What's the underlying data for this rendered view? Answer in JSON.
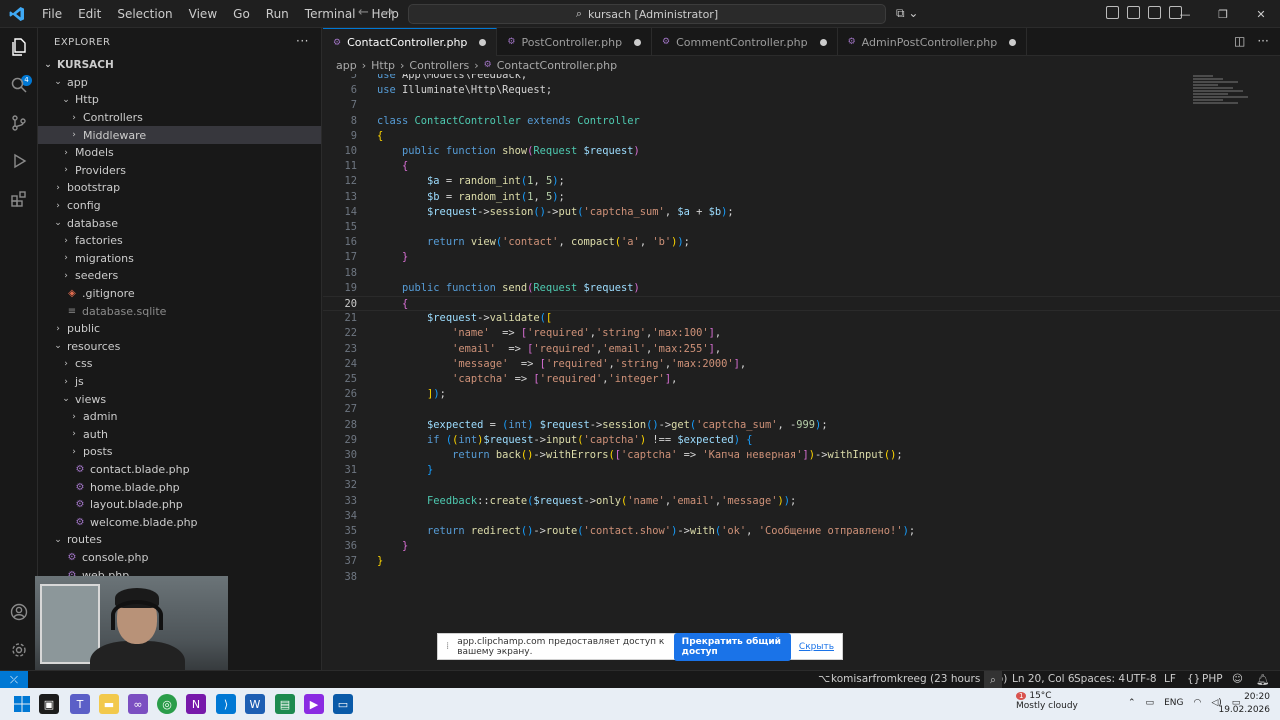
{
  "titlebar": {
    "menu": [
      "File",
      "Edit",
      "Selection",
      "View",
      "Go",
      "Run",
      "Terminal",
      "Help"
    ],
    "search_text": "kursach [Administrator]"
  },
  "sidebar": {
    "header": "EXPLORER",
    "root": "KURSACH",
    "items": [
      {
        "label": "app",
        "depth": 1,
        "type": "folder-open"
      },
      {
        "label": "Http",
        "depth": 2,
        "type": "folder-open"
      },
      {
        "label": "Controllers",
        "depth": 3,
        "type": "folder"
      },
      {
        "label": "Middleware",
        "depth": 3,
        "type": "folder",
        "selected": true
      },
      {
        "label": "Models",
        "depth": 2,
        "type": "folder"
      },
      {
        "label": "Providers",
        "depth": 2,
        "type": "folder"
      },
      {
        "label": "bootstrap",
        "depth": 1,
        "type": "folder"
      },
      {
        "label": "config",
        "depth": 1,
        "type": "folder"
      },
      {
        "label": "database",
        "depth": 1,
        "type": "folder-open"
      },
      {
        "label": "factories",
        "depth": 2,
        "type": "folder"
      },
      {
        "label": "migrations",
        "depth": 2,
        "type": "folder"
      },
      {
        "label": "seeders",
        "depth": 2,
        "type": "folder"
      },
      {
        "label": ".gitignore",
        "depth": 2,
        "type": "git"
      },
      {
        "label": "database.sqlite",
        "depth": 2,
        "type": "db",
        "dim": true
      },
      {
        "label": "public",
        "depth": 1,
        "type": "folder"
      },
      {
        "label": "resources",
        "depth": 1,
        "type": "folder-open"
      },
      {
        "label": "css",
        "depth": 2,
        "type": "folder"
      },
      {
        "label": "js",
        "depth": 2,
        "type": "folder"
      },
      {
        "label": "views",
        "depth": 2,
        "type": "folder-open"
      },
      {
        "label": "admin",
        "depth": 3,
        "type": "folder"
      },
      {
        "label": "auth",
        "depth": 3,
        "type": "folder"
      },
      {
        "label": "posts",
        "depth": 3,
        "type": "folder"
      },
      {
        "label": "contact.blade.php",
        "depth": 3,
        "type": "php"
      },
      {
        "label": "home.blade.php",
        "depth": 3,
        "type": "php"
      },
      {
        "label": "layout.blade.php",
        "depth": 3,
        "type": "php"
      },
      {
        "label": "welcome.blade.php",
        "depth": 3,
        "type": "php"
      },
      {
        "label": "routes",
        "depth": 1,
        "type": "folder-open"
      },
      {
        "label": "console.php",
        "depth": 2,
        "type": "php"
      },
      {
        "label": "web.php",
        "depth": 2,
        "type": "php"
      }
    ]
  },
  "tabs": [
    {
      "label": "ContactController.php",
      "active": true
    },
    {
      "label": "PostController.php",
      "active": false
    },
    {
      "label": "CommentController.php",
      "active": false
    },
    {
      "label": "AdminPostController.php",
      "active": false
    }
  ],
  "breadcrumb": [
    "app",
    "Http",
    "Controllers",
    "ContactController.php"
  ],
  "editor": {
    "current_line": 20,
    "lines": [
      {
        "n": 5,
        "tokens": [
          [
            "k",
            "use "
          ],
          [
            "p",
            "App\\Models\\Feedback;"
          ]
        ]
      },
      {
        "n": 6,
        "tokens": [
          [
            "k",
            "use "
          ],
          [
            "p",
            "Illuminate\\Http\\Request;"
          ]
        ]
      },
      {
        "n": 7,
        "tokens": []
      },
      {
        "n": 8,
        "tokens": [
          [
            "k",
            "class "
          ],
          [
            "c",
            "ContactController "
          ],
          [
            "k",
            "extends "
          ],
          [
            "c",
            "Controller"
          ]
        ]
      },
      {
        "n": 9,
        "tokens": [
          [
            "b1",
            "{"
          ]
        ]
      },
      {
        "n": 10,
        "tokens": [
          [
            "p",
            "    "
          ],
          [
            "k",
            "public function "
          ],
          [
            "f",
            "show"
          ],
          [
            "b2",
            "("
          ],
          [
            "c",
            "Request "
          ],
          [
            "v",
            "$request"
          ],
          [
            "b2",
            ")"
          ]
        ]
      },
      {
        "n": 11,
        "tokens": [
          [
            "p",
            "    "
          ],
          [
            "b2",
            "{"
          ]
        ]
      },
      {
        "n": 12,
        "tokens": [
          [
            "p",
            "        "
          ],
          [
            "v",
            "$a"
          ],
          [
            "p",
            " = "
          ],
          [
            "f",
            "random_int"
          ],
          [
            "b3",
            "("
          ],
          [
            "n",
            "1"
          ],
          [
            "p",
            ", "
          ],
          [
            "n",
            "5"
          ],
          [
            "b3",
            ")"
          ],
          [
            "p",
            ";"
          ]
        ]
      },
      {
        "n": 13,
        "tokens": [
          [
            "p",
            "        "
          ],
          [
            "v",
            "$b"
          ],
          [
            "p",
            " = "
          ],
          [
            "f",
            "random_int"
          ],
          [
            "b3",
            "("
          ],
          [
            "n",
            "1"
          ],
          [
            "p",
            ", "
          ],
          [
            "n",
            "5"
          ],
          [
            "b3",
            ")"
          ],
          [
            "p",
            ";"
          ]
        ]
      },
      {
        "n": 14,
        "tokens": [
          [
            "p",
            "        "
          ],
          [
            "v",
            "$request"
          ],
          [
            "p",
            "->"
          ],
          [
            "f",
            "session"
          ],
          [
            "b3",
            "()"
          ],
          [
            "p",
            "->"
          ],
          [
            "f",
            "put"
          ],
          [
            "b3",
            "("
          ],
          [
            "s",
            "'captcha_sum'"
          ],
          [
            "p",
            ", "
          ],
          [
            "v",
            "$a"
          ],
          [
            "p",
            " + "
          ],
          [
            "v",
            "$b"
          ],
          [
            "b3",
            ")"
          ],
          [
            "p",
            ";"
          ]
        ]
      },
      {
        "n": 15,
        "tokens": []
      },
      {
        "n": 16,
        "tokens": [
          [
            "p",
            "        "
          ],
          [
            "k",
            "return "
          ],
          [
            "f",
            "view"
          ],
          [
            "b3",
            "("
          ],
          [
            "s",
            "'contact'"
          ],
          [
            "p",
            ", "
          ],
          [
            "f",
            "compact"
          ],
          [
            "b1",
            "("
          ],
          [
            "s",
            "'a'"
          ],
          [
            "p",
            ", "
          ],
          [
            "s",
            "'b'"
          ],
          [
            "b1",
            ")"
          ],
          [
            "b3",
            ")"
          ],
          [
            "p",
            ";"
          ]
        ]
      },
      {
        "n": 17,
        "tokens": [
          [
            "p",
            "    "
          ],
          [
            "b2",
            "}"
          ]
        ]
      },
      {
        "n": 18,
        "tokens": []
      },
      {
        "n": 19,
        "tokens": [
          [
            "p",
            "    "
          ],
          [
            "k",
            "public function "
          ],
          [
            "f",
            "send"
          ],
          [
            "b2",
            "("
          ],
          [
            "c",
            "Request "
          ],
          [
            "v",
            "$request"
          ],
          [
            "b2",
            ")"
          ]
        ]
      },
      {
        "n": 20,
        "tokens": [
          [
            "p",
            "    "
          ],
          [
            "b2",
            "{"
          ]
        ]
      },
      {
        "n": 21,
        "tokens": [
          [
            "p",
            "        "
          ],
          [
            "v",
            "$request"
          ],
          [
            "p",
            "->"
          ],
          [
            "f",
            "validate"
          ],
          [
            "b3",
            "("
          ],
          [
            "b1",
            "["
          ]
        ]
      },
      {
        "n": 22,
        "tokens": [
          [
            "p",
            "            "
          ],
          [
            "s",
            "'name'"
          ],
          [
            "p",
            "  => "
          ],
          [
            "b2",
            "["
          ],
          [
            "s",
            "'required'"
          ],
          [
            "p",
            ","
          ],
          [
            "s",
            "'string'"
          ],
          [
            "p",
            ","
          ],
          [
            "s",
            "'max:100'"
          ],
          [
            "b2",
            "]"
          ],
          [
            "p",
            ","
          ]
        ]
      },
      {
        "n": 23,
        "tokens": [
          [
            "p",
            "            "
          ],
          [
            "s",
            "'email'"
          ],
          [
            "p",
            "  => "
          ],
          [
            "b2",
            "["
          ],
          [
            "s",
            "'required'"
          ],
          [
            "p",
            ","
          ],
          [
            "s",
            "'email'"
          ],
          [
            "p",
            ","
          ],
          [
            "s",
            "'max:255'"
          ],
          [
            "b2",
            "]"
          ],
          [
            "p",
            ","
          ]
        ]
      },
      {
        "n": 24,
        "tokens": [
          [
            "p",
            "            "
          ],
          [
            "s",
            "'message'"
          ],
          [
            "p",
            "  => "
          ],
          [
            "b2",
            "["
          ],
          [
            "s",
            "'required'"
          ],
          [
            "p",
            ","
          ],
          [
            "s",
            "'string'"
          ],
          [
            "p",
            ","
          ],
          [
            "s",
            "'max:2000'"
          ],
          [
            "b2",
            "]"
          ],
          [
            "p",
            ","
          ]
        ]
      },
      {
        "n": 25,
        "tokens": [
          [
            "p",
            "            "
          ],
          [
            "s",
            "'captcha'"
          ],
          [
            "p",
            " => "
          ],
          [
            "b2",
            "["
          ],
          [
            "s",
            "'required'"
          ],
          [
            "p",
            ","
          ],
          [
            "s",
            "'integer'"
          ],
          [
            "b2",
            "]"
          ],
          [
            "p",
            ","
          ]
        ]
      },
      {
        "n": 26,
        "tokens": [
          [
            "p",
            "        "
          ],
          [
            "b1",
            "]"
          ],
          [
            "b3",
            ")"
          ],
          [
            "p",
            ";"
          ]
        ]
      },
      {
        "n": 27,
        "tokens": []
      },
      {
        "n": 28,
        "tokens": [
          [
            "p",
            "        "
          ],
          [
            "v",
            "$expected"
          ],
          [
            "p",
            " = "
          ],
          [
            "b3",
            "("
          ],
          [
            "k",
            "int"
          ],
          [
            "b3",
            ")"
          ],
          [
            "p",
            " "
          ],
          [
            "v",
            "$request"
          ],
          [
            "p",
            "->"
          ],
          [
            "f",
            "session"
          ],
          [
            "b3",
            "()"
          ],
          [
            "p",
            "->"
          ],
          [
            "f",
            "get"
          ],
          [
            "b3",
            "("
          ],
          [
            "s",
            "'captcha_sum'"
          ],
          [
            "p",
            ", -"
          ],
          [
            "n",
            "999"
          ],
          [
            "b3",
            ")"
          ],
          [
            "p",
            ";"
          ]
        ]
      },
      {
        "n": 29,
        "tokens": [
          [
            "p",
            "        "
          ],
          [
            "k",
            "if "
          ],
          [
            "b3",
            "("
          ],
          [
            "b1",
            "("
          ],
          [
            "k",
            "int"
          ],
          [
            "b1",
            ")"
          ],
          [
            "v",
            "$request"
          ],
          [
            "p",
            "->"
          ],
          [
            "f",
            "input"
          ],
          [
            "b1",
            "("
          ],
          [
            "s",
            "'captcha'"
          ],
          [
            "b1",
            ")"
          ],
          [
            "p",
            " !== "
          ],
          [
            "v",
            "$expected"
          ],
          [
            "b3",
            ")"
          ],
          [
            "p",
            " "
          ],
          [
            "b3",
            "{"
          ]
        ]
      },
      {
        "n": 30,
        "tokens": [
          [
            "p",
            "            "
          ],
          [
            "k",
            "return "
          ],
          [
            "f",
            "back"
          ],
          [
            "b1",
            "()"
          ],
          [
            "p",
            "->"
          ],
          [
            "f",
            "withErrors"
          ],
          [
            "b1",
            "("
          ],
          [
            "b2",
            "["
          ],
          [
            "s",
            "'captcha'"
          ],
          [
            "p",
            " => "
          ],
          [
            "s",
            "'Капча неверная'"
          ],
          [
            "b2",
            "]"
          ],
          [
            "b1",
            ")"
          ],
          [
            "p",
            "->"
          ],
          [
            "f",
            "withInput"
          ],
          [
            "b1",
            "()"
          ],
          [
            "p",
            ";"
          ]
        ]
      },
      {
        "n": 31,
        "tokens": [
          [
            "p",
            "        "
          ],
          [
            "b3",
            "}"
          ]
        ]
      },
      {
        "n": 32,
        "tokens": []
      },
      {
        "n": 33,
        "tokens": [
          [
            "p",
            "        "
          ],
          [
            "c",
            "Feedback"
          ],
          [
            "p",
            "::"
          ],
          [
            "f",
            "create"
          ],
          [
            "b3",
            "("
          ],
          [
            "v",
            "$request"
          ],
          [
            "p",
            "->"
          ],
          [
            "f",
            "only"
          ],
          [
            "b1",
            "("
          ],
          [
            "s",
            "'name'"
          ],
          [
            "p",
            ","
          ],
          [
            "s",
            "'email'"
          ],
          [
            "p",
            ","
          ],
          [
            "s",
            "'message'"
          ],
          [
            "b1",
            ")"
          ],
          [
            "b3",
            ")"
          ],
          [
            "p",
            ";"
          ]
        ]
      },
      {
        "n": 34,
        "tokens": []
      },
      {
        "n": 35,
        "tokens": [
          [
            "p",
            "        "
          ],
          [
            "k",
            "return "
          ],
          [
            "f",
            "redirect"
          ],
          [
            "b3",
            "()"
          ],
          [
            "p",
            "->"
          ],
          [
            "f",
            "route"
          ],
          [
            "b3",
            "("
          ],
          [
            "s",
            "'contact.show'"
          ],
          [
            "b3",
            ")"
          ],
          [
            "p",
            "->"
          ],
          [
            "f",
            "with"
          ],
          [
            "b3",
            "("
          ],
          [
            "s",
            "'ok'"
          ],
          [
            "p",
            ", "
          ],
          [
            "s",
            "'Сообщение отправлено!'"
          ],
          [
            "b3",
            ")"
          ],
          [
            "p",
            ";"
          ]
        ]
      },
      {
        "n": 36,
        "tokens": [
          [
            "p",
            "    "
          ],
          [
            "b2",
            "}"
          ]
        ]
      },
      {
        "n": 37,
        "tokens": [
          [
            "b1",
            "}"
          ]
        ]
      },
      {
        "n": 38,
        "tokens": []
      }
    ]
  },
  "sharebar": {
    "message": "app.clipchamp.com предоставляет доступ к вашему экрану.",
    "stop_label": "Прекратить общий доступ",
    "hide_label": "Скрыть"
  },
  "statusbar": {
    "blame": "komisarfromkreeg (23 hours ago)",
    "position": "Ln 20, Col 6",
    "spaces": "Spaces: 4",
    "encoding": "UTF-8",
    "eol": "LF",
    "language": "PHP"
  },
  "taskbar": {
    "weather_badge": "1",
    "temperature": "15°C",
    "weather_text": "Mostly cloudy",
    "lang": "ENG",
    "time": "20:20",
    "date": "19.02.2026"
  }
}
